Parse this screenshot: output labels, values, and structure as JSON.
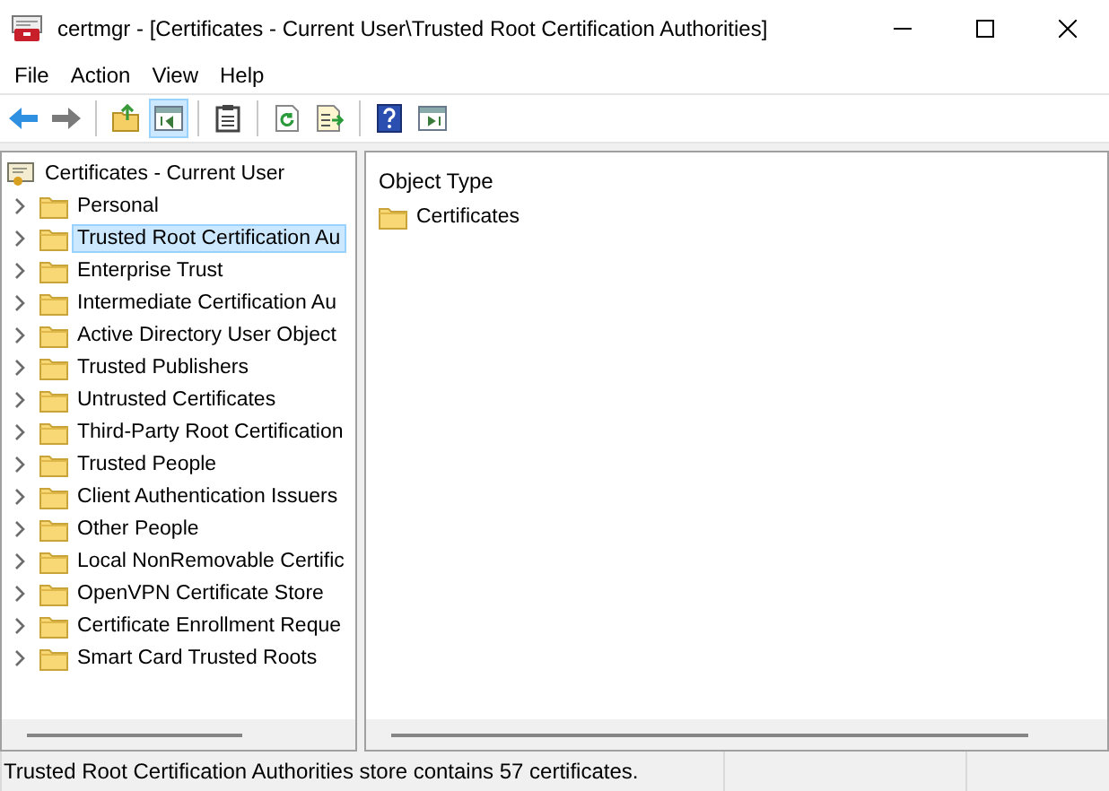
{
  "window": {
    "title": "certmgr - [Certificates - Current User\\Trusted Root Certification Authorities]"
  },
  "menu": [
    "File",
    "Action",
    "View",
    "Help"
  ],
  "toolbar": [
    {
      "kind": "back",
      "pressed": false
    },
    {
      "kind": "forward",
      "pressed": false
    },
    {
      "kind": "sep"
    },
    {
      "kind": "up",
      "pressed": false
    },
    {
      "kind": "tree",
      "pressed": true
    },
    {
      "kind": "sep"
    },
    {
      "kind": "clipboard",
      "pressed": false
    },
    {
      "kind": "sep"
    },
    {
      "kind": "refresh",
      "pressed": false
    },
    {
      "kind": "export",
      "pressed": false
    },
    {
      "kind": "sep"
    },
    {
      "kind": "help",
      "pressed": false
    },
    {
      "kind": "action",
      "pressed": false
    }
  ],
  "tree": {
    "root": "Certificates - Current User",
    "children": [
      {
        "label": "Personal",
        "selected": false,
        "expanded": false
      },
      {
        "label": "Trusted Root Certification Au",
        "selected": true,
        "expanded": false
      },
      {
        "label": "Enterprise Trust",
        "selected": false,
        "expanded": false
      },
      {
        "label": "Intermediate Certification Au",
        "selected": false,
        "expanded": false
      },
      {
        "label": "Active Directory User Object",
        "selected": false,
        "expanded": false
      },
      {
        "label": "Trusted Publishers",
        "selected": false,
        "expanded": false
      },
      {
        "label": "Untrusted Certificates",
        "selected": false,
        "expanded": false
      },
      {
        "label": "Third-Party Root Certification",
        "selected": false,
        "expanded": false
      },
      {
        "label": "Trusted People",
        "selected": false,
        "expanded": false
      },
      {
        "label": "Client Authentication Issuers",
        "selected": false,
        "expanded": false
      },
      {
        "label": "Other People",
        "selected": false,
        "expanded": false
      },
      {
        "label": "Local NonRemovable Certific",
        "selected": false,
        "expanded": false
      },
      {
        "label": "OpenVPN Certificate Store",
        "selected": false,
        "expanded": false
      },
      {
        "label": "Certificate Enrollment Reque",
        "selected": false,
        "expanded": false
      },
      {
        "label": "Smart Card Trusted Roots",
        "selected": false,
        "expanded": false
      }
    ]
  },
  "list": {
    "column": "Object Type",
    "items": [
      "Certificates"
    ]
  },
  "status_bar": {
    "text": "Trusted Root Certification Authorities store contains 57 certificates."
  }
}
